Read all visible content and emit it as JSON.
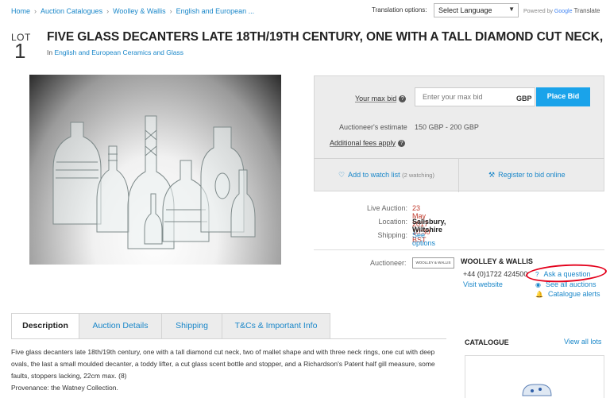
{
  "breadcrumb": [
    {
      "label": "Home"
    },
    {
      "label": "Auction Catalogues"
    },
    {
      "label": "Woolley & Wallis"
    },
    {
      "label": "English and European ..."
    }
  ],
  "translation": {
    "label": "Translation options:",
    "select_value": "Select Language",
    "powered_by": "Powered by",
    "google": "Google",
    "translate": "Translate"
  },
  "lot": {
    "lot_label": "LOT",
    "number": "1",
    "title": "FIVE GLASS DECANTERS LATE 18TH/19TH CENTURY, ONE WITH A TALL DIAMOND CUT NECK,",
    "in_label": "In",
    "category": "English and European Ceramics and Glass"
  },
  "bid": {
    "max_bid_label": "Your max bid",
    "input_placeholder": "Enter your max bid",
    "currency": "GBP",
    "place_bid": "Place Bid",
    "estimate_label": "Auctioneer's estimate",
    "estimate_value": "150 GBP - 200 GBP",
    "fees_label": "Additional fees apply",
    "watch_label": "Add to watch list",
    "watch_count": "(2 watching)",
    "register_label": "Register to bid online"
  },
  "auction_info": {
    "live_label": "Live Auction:",
    "live_value": "23 May 2017 10:30 BST",
    "location_label": "Location:",
    "location_value": "Salisbury, Wiltshire",
    "shipping_label": "Shipping:",
    "shipping_value": "See options"
  },
  "auctioneer": {
    "label": "Auctioneer:",
    "logo_text": "WOOLLEY & WALLIS",
    "name": "WOOLLEY & WALLIS",
    "phone": "+44 (0)1722 424500",
    "website": "Visit website",
    "ask": "Ask a question",
    "see_all": "See all auctions",
    "alerts": "Catalogue alerts"
  },
  "tabs": [
    {
      "label": "Description",
      "active": true
    },
    {
      "label": "Auction Details",
      "active": false
    },
    {
      "label": "Shipping",
      "active": false
    },
    {
      "label": "T&Cs & Important Info",
      "active": false
    }
  ],
  "description": {
    "text": "Five glass decanters late 18th/19th century, one with a tall diamond cut neck, two of mallet shape and with three neck rings, one cut with deep ovals, the last a small moulded decanter, a toddy lifter, a cut glass scent bottle and stopper, and a Richardson's Patent half gill measure, some faults, stoppers lacking, 22cm max. (8)",
    "provenance": "Provenance: the Watney Collection."
  },
  "catalogue": {
    "title": "CATALOGUE",
    "view_all": "View all lots"
  },
  "colors": {
    "link": "#1a87c9",
    "place_bid_bg": "#1aa3ea",
    "live_red": "#c0392b",
    "annotation_ring": "#e3001b"
  }
}
